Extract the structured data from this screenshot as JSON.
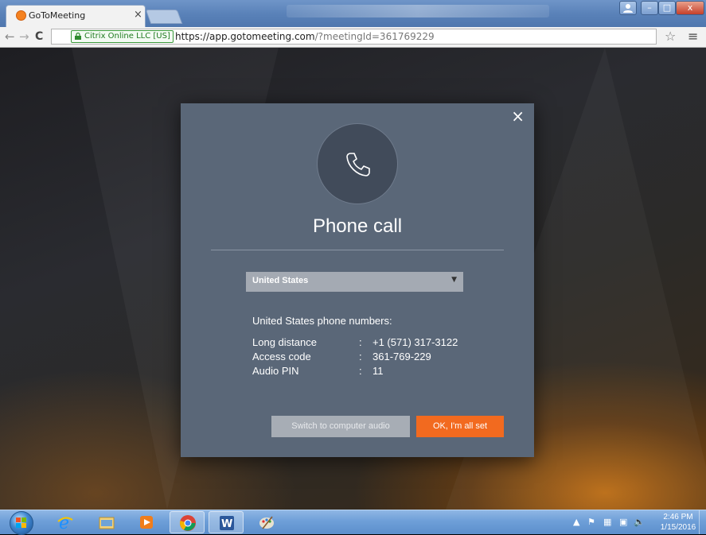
{
  "browser": {
    "tab_title": "GoToMeeting",
    "tab_close": "×",
    "nav_back": "←",
    "nav_forward": "→",
    "nav_reload": "C",
    "security_badge": "Citrix Online LLC [US]",
    "url_host": "https://app.gotomeeting.com",
    "url_path": "/?meetingId=361769229",
    "bookmark_star": "☆",
    "menu": "≡",
    "window_buttons": {
      "minimize": "–",
      "maximize": "□",
      "close": "x"
    }
  },
  "dialog": {
    "close": "×",
    "title": "Phone call",
    "country_select": {
      "selected": "United States",
      "caret": "▼"
    },
    "numbers_heading": "United States phone numbers:",
    "rows": [
      {
        "label": "Long distance",
        "sep": ":",
        "value": "+1 (571) 317-3122"
      },
      {
        "label": "Access code",
        "sep": ":",
        "value": "361-769-229"
      },
      {
        "label": "Audio PIN",
        "sep": ":",
        "value": "11"
      }
    ],
    "switch_button": "Switch to computer audio",
    "ok_button": "OK, I'm all set"
  },
  "taskbar": {
    "apps": [
      "internet-explorer",
      "windows-explorer",
      "media-player",
      "chrome",
      "word",
      "paint"
    ],
    "clock_time": "2:46 PM",
    "clock_date": "1/15/2016"
  },
  "colors": {
    "dialog_bg": "#5a6778",
    "accent_orange": "#f26a1f",
    "secondary_button": "#a7adb5",
    "select_bg": "#a4aab3"
  }
}
